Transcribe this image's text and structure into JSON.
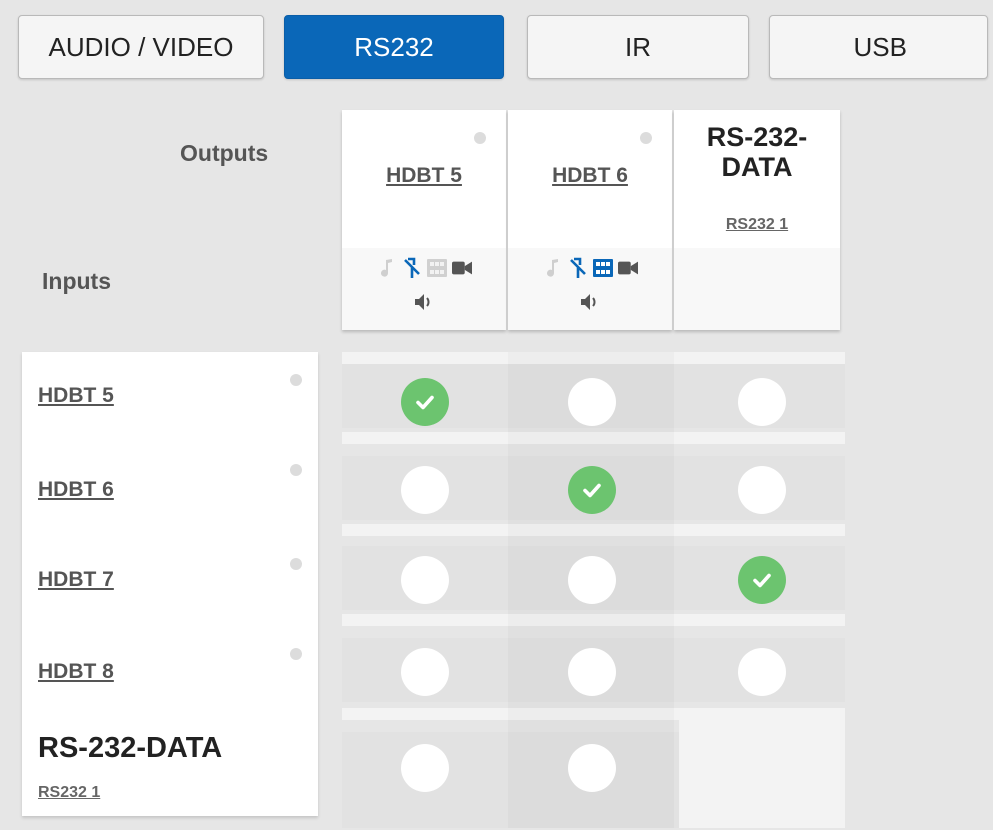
{
  "tabs": [
    {
      "label": "AUDIO / VIDEO",
      "active": false
    },
    {
      "label": "RS232",
      "active": true
    },
    {
      "label": "IR",
      "active": false
    },
    {
      "label": "USB",
      "active": false
    }
  ],
  "matrix": {
    "outputs_label": "Outputs",
    "inputs_label": "Inputs",
    "outputs": [
      {
        "label": "HDBT 5",
        "status_dot": true,
        "icons": [
          "music-note-icon",
          "split-arrow-icon",
          "grid-pattern-icon",
          "video-camera-icon",
          "speaker-icon"
        ]
      },
      {
        "label": "HDBT 6",
        "status_dot": true,
        "icons": [
          "music-note-icon",
          "split-arrow-icon",
          "grid-pattern-icon",
          "video-camera-icon",
          "speaker-icon"
        ]
      },
      {
        "title": "RS-232-DATA",
        "title_line1": "RS-232-",
        "title_line2": "DATA",
        "sub": "RS232 1"
      }
    ],
    "inputs": [
      {
        "label": "HDBT 5",
        "status_dot": true
      },
      {
        "label": "HDBT 6",
        "status_dot": true
      },
      {
        "label": "HDBT 7",
        "status_dot": true
      },
      {
        "label": "HDBT 8",
        "status_dot": true
      },
      {
        "title": "RS-232-DATA",
        "sub": "RS232 1"
      }
    ],
    "routes": [
      [
        true,
        false,
        false
      ],
      [
        false,
        true,
        false
      ],
      [
        false,
        false,
        true
      ],
      [
        false,
        false,
        false
      ],
      [
        false,
        false,
        null
      ]
    ]
  },
  "colors": {
    "accent": "#0a67b8",
    "connected": "#6cc46f",
    "icon_active": "#0a67b8",
    "icon_inactive": "#c8c8c8",
    "icon_dark": "#555555"
  }
}
